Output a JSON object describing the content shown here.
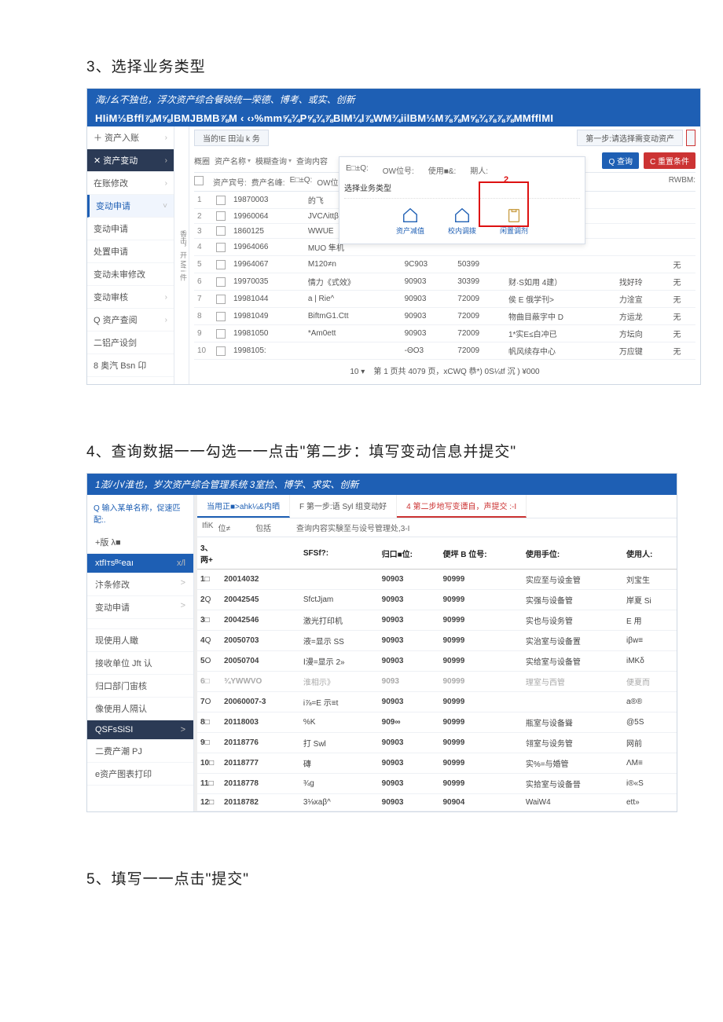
{
  "headings": {
    "h3": "3、选择业务类型",
    "h4": "4、查询数据一一勾选一一点击\"第二步：填写变动信息并提交\"",
    "h5": "5、填写一一点击\"提交\""
  },
  "sys1": {
    "topbar": "海;/幺不独也，浮次资产综合餐映统一荣德、博考、或实、创新",
    "topbar2": "HIiM⅓Bffl⅞M⅝lBMJBMB⅞M    ‹ ‹›%mm⅝¾P⅝¾⅞BlM¼l⅞WM¾iilBM⅓M⅞⅞M⅝¾⅞⅞⅞MMfflMI",
    "status": "当的!E 田汕 k 务",
    "stepLabel": "第一步:请选择需变动资产",
    "side": [
      {
        "label": "＋ 资产入账",
        "cls": "",
        "caret": "›"
      },
      {
        "label": "✕ 资产变动",
        "cls": "dark",
        "caret": "›"
      },
      {
        "label": "在账修改",
        "cls": "",
        "caret": "›"
      },
      {
        "label": "变动申请",
        "cls": "blue",
        "caret": "˅"
      },
      {
        "label": "变动申请",
        "cls": "",
        "caret": ""
      },
      {
        "label": "处置申请",
        "cls": "",
        "caret": ""
      },
      {
        "label": "变动未审修改",
        "cls": "",
        "caret": ""
      },
      {
        "label": "变动审核",
        "cls": "",
        "caret": "›"
      },
      {
        "label": "Q 资产查阅",
        "cls": "",
        "caret": "›"
      },
      {
        "label": "二铝产设剑",
        "cls": "",
        "caret": ""
      },
      {
        "label": "8 奥汽 Bsn 卬",
        "cls": "",
        "caret": ""
      }
    ],
    "vert": "香击，开 Mf i 件",
    "filterLabels": {
      "fanwei": "概圈",
      "mingcheng": "资产名称",
      "mohu": "模糊查询",
      "search": "查询内容",
      "btnQ": "Q 查询",
      "btnR": "C 重置条件"
    },
    "colHeads": {
      "zcid": "资产宾号:",
      "zcname": "费产名峰:",
      "cunfang": "E□±Q:",
      "ow": "OW位号:",
      "shiyong": "使用■&:",
      "title": "期人:",
      "rwbm": "RWBM:"
    },
    "dialog": {
      "title": "选择业务类型",
      "icons": [
        {
          "name": "asset-decrease-icon",
          "label": "资产减值"
        },
        {
          "name": "on-campus-transfer-icon",
          "label": "校内调拨"
        },
        {
          "name": "idle-transfer-icon",
          "label": "闲置调剂"
        }
      ]
    },
    "rows": [
      {
        "n": "1",
        "a": "19870003",
        "b": "的飞"
      },
      {
        "n": "2",
        "a": "19960064",
        "b": "JVCΛittβ"
      },
      {
        "n": "3",
        "a": "1860125",
        "b": "WWUE"
      },
      {
        "n": "4",
        "a": "19964066",
        "b": "MUO 隼机"
      },
      {
        "n": "5",
        "a": "19964067",
        "b": "M120≠n",
        "c": "9C903",
        "d": "50399",
        "e": "",
        "f": "",
        "g": "无"
      },
      {
        "n": "6",
        "a": "19970035",
        "b": "情力《式效》",
        "c": "90903",
        "d": "30399",
        "e": "财·S如用 4建）",
        "f": "找好玲",
        "g": "无"
      },
      {
        "n": "7",
        "a": "19981044",
        "b": "a | Rie^",
        "c": "90903",
        "d": "72009",
        "e": "侯 E 俄学刊>",
        "f": "力淦宣",
        "g": "无"
      },
      {
        "n": "8",
        "a": "19981049",
        "b": "BiftmG1.Ctt",
        "c": "90903",
        "d": "72009",
        "e": "物曲目蔽字中 D",
        "f": "方运龙",
        "g": "无"
      },
      {
        "n": "9",
        "a": "19981050",
        "b": "*Am0ett",
        "c": "90903",
        "d": "72009",
        "e": "1*实E≤白冲已",
        "f": "方坛向",
        "g": "无"
      },
      {
        "n": "10",
        "a": "1998105:",
        "b": "",
        "c": "-ΘO3",
        "d": "72009",
        "e": "帆风续存中心",
        "f": "万应键",
        "g": "无"
      }
    ],
    "pager": "第 1 页共 4079 页，xCWQ 恭*) 0S¼tf 沉 ) ¥000",
    "perpage": "10"
  },
  "sys2": {
    "topbar": "1澎/小/淮也，岁次资产综合管理系统 3室捡、博学、求实、创新",
    "searchHint": "Q 输入某单名称，促速匹配:.",
    "side": [
      {
        "label": "+版 λ■",
        "cls": ""
      },
      {
        "label": "xtfIтsᴮᶜeaı",
        "cls": "darkblue",
        "caret": "x/l"
      },
      {
        "label": "汴条修改",
        "cls": "",
        "caret": ">"
      },
      {
        "label": "变动申请",
        "cls": "",
        "caret": ">"
      },
      {
        "label": "",
        "cls": "",
        "caret": ""
      },
      {
        "label": "现使用人瞰",
        "cls": "",
        "caret": ""
      },
      {
        "label": "接收单位 Jft 认",
        "cls": "",
        "caret": ""
      },
      {
        "label": "归口部门宙核",
        "cls": "",
        "caret": ""
      },
      {
        "label": "像使用人隔认",
        "cls": "",
        "caret": ""
      },
      {
        "label": "QSFsSiSI",
        "cls": "dark",
        "caret": ">"
      },
      {
        "label": "二费产潮 PJ",
        "cls": "",
        "caret": ""
      },
      {
        "label": "e资产图表打印",
        "cls": "",
        "caret": ""
      }
    ],
    "tabs": [
      {
        "label": "当用正■>ahk¼&内晒",
        "cls": "active"
      },
      {
        "label": "F 第一步:语 Syl 组变动好",
        "cls": ""
      },
      {
        "label": "4 第二步地写变谭自，声提交 :-I",
        "cls": "red"
      }
    ],
    "hdr": {
      "a": "IfiK",
      "b": "位≠",
      "c": "包括",
      "d": "查询内容实験至与设号管理处,3-I"
    },
    "th": {
      "idx": "3、两+",
      "sn": "",
      "name": "SFSf?:",
      "guikou": "归口■位:",
      "bian": "便坪 B 位号:",
      "dw": "使用手位:",
      "ren": "使用人:"
    },
    "rows": [
      {
        "i": "1",
        "ck": "□",
        "sn": "20014032",
        "name": "",
        "gk": "90903",
        "b": "90999",
        "dw": "实应至与设金管",
        "r": "刘宝生"
      },
      {
        "i": "2",
        "ck": "Q",
        "sn": "20042545",
        "name": "SfctJjam",
        "gk": "90903",
        "b": "90999",
        "dw": "实强与设备管",
        "r": "岸夏 Si"
      },
      {
        "i": "3",
        "ck": "□",
        "sn": "20042546",
        "name": "激光打印机",
        "gk": "90903",
        "b": "90999",
        "dw": "实也与设务管",
        "r": "E 用"
      },
      {
        "i": "4",
        "ck": "Q",
        "sn": "20050703",
        "name": "液=显示 SS",
        "gk": "90903",
        "b": "90999",
        "dw": "实治室与设备置",
        "r": "iβw≡"
      },
      {
        "i": "5",
        "ck": "O",
        "sn": "20050704",
        "name": "Ⅰ漫=显示 2»",
        "gk": "90903",
        "b": "90999",
        "dw": "实给室与设备管",
        "r": "iMKδ"
      },
      {
        "i": "6",
        "ck": "□",
        "sn": "¾YWWVO",
        "name": "淮相示》",
        "gk": "9093",
        "b": "90999",
        "dw": "理室与西管",
        "r": "便夏而",
        "mute": true
      },
      {
        "i": "7",
        "ck": "O",
        "sn": "20060007-3",
        "name": "i⅞=E 示≡t",
        "gk": "90903",
        "b": "90999",
        "dw": "",
        "r": "a®®"
      },
      {
        "i": "8",
        "ck": "□",
        "sn": "20118003",
        "name": "%K",
        "gk": "909∞",
        "b": "90999",
        "dw": "瓶室与设备聳",
        "r": "@5S"
      },
      {
        "i": "9",
        "ck": "□",
        "sn": "20118776",
        "name": "打 Swl",
        "gk": "90903",
        "b": "90999",
        "dw": "翎室与设务管",
        "r": "网前"
      },
      {
        "i": "10",
        "ck": "□",
        "sn": "20118777",
        "name": "磚",
        "gk": "90903",
        "b": "90999",
        "dw": "实%=与婚管",
        "r": "ΛM≡"
      },
      {
        "i": "11",
        "ck": "□",
        "sn": "20118778",
        "name": "¾g",
        "gk": "90903",
        "b": "90999",
        "dw": "实拾室与设备晉",
        "r": "i®«S"
      },
      {
        "i": "12",
        "ck": "□",
        "sn": "20118782",
        "name": "3⅛xaβ^",
        "gk": "90903",
        "b": "90904",
        "dw": "WaiW4",
        "r": "ett»"
      }
    ]
  }
}
